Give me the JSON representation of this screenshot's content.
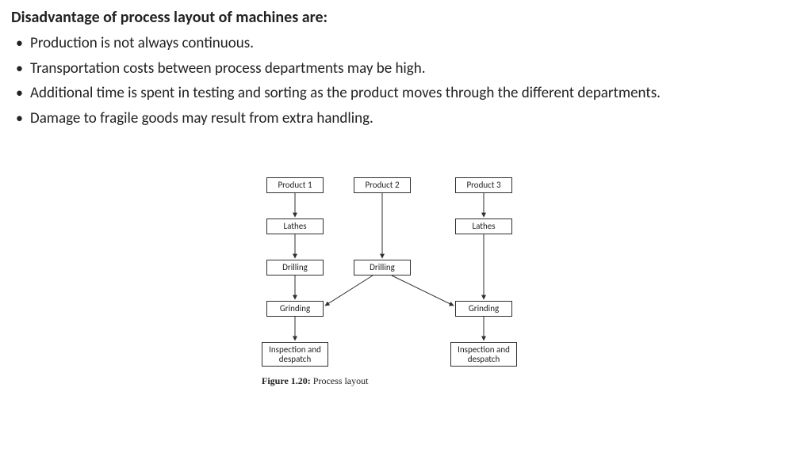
{
  "heading": "Disadvantage of process layout of machines are:",
  "bullets": [
    "Production is not always continuous.",
    "Transportation costs between process departments may be high.",
    "Additional time is spent in testing and sorting as the product moves through the different departments.",
    "Damage to fragile goods may result from extra handling."
  ],
  "diagram": {
    "boxes": {
      "p1": "Product 1",
      "p2": "Product 2",
      "p3": "Product 3",
      "lathes1": "Lathes",
      "lathes3": "Lathes",
      "drill1": "Drilling",
      "drill2": "Drilling",
      "grind1": "Grinding",
      "grind3": "Grinding",
      "insp1": "Inspection and despatch",
      "insp3": "Inspection and despatch"
    },
    "caption_bold": "Figure 1.20:",
    "caption_rest": " Process layout"
  }
}
